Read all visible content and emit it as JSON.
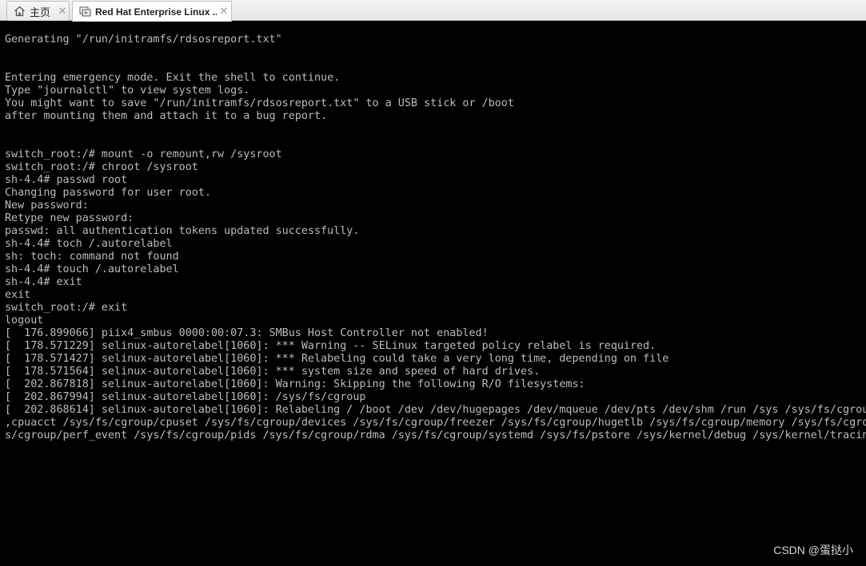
{
  "tabs": {
    "home": {
      "label": "主页",
      "icon": "home-icon"
    },
    "vm": {
      "label": "Red Hat Enterprise Linux ...",
      "icon": "vm-icon"
    }
  },
  "console": {
    "lines": [
      "Generating \"/run/initramfs/rdsosreport.txt\"",
      "",
      "",
      "Entering emergency mode. Exit the shell to continue.",
      "Type \"journalctl\" to view system logs.",
      "You might want to save \"/run/initramfs/rdsosreport.txt\" to a USB stick or /boot",
      "after mounting them and attach it to a bug report.",
      "",
      "",
      "switch_root:/# mount -o remount,rw /sysroot",
      "switch_root:/# chroot /sysroot",
      "sh-4.4# passwd root",
      "Changing password for user root.",
      "New password:",
      "Retype new password:",
      "passwd: all authentication tokens updated successfully.",
      "sh-4.4# toch /.autorelabel",
      "sh: toch: command not found",
      "sh-4.4# touch /.autorelabel",
      "sh-4.4# exit",
      "exit",
      "switch_root:/# exit",
      "logout",
      "[  176.899066] piix4_smbus 0000:00:07.3: SMBus Host Controller not enabled!",
      "[  178.571229] selinux-autorelabel[1060]: *** Warning -- SELinux targeted policy relabel is required.",
      "[  178.571427] selinux-autorelabel[1060]: *** Relabeling could take a very long time, depending on file",
      "[  178.571564] selinux-autorelabel[1060]: *** system size and speed of hard drives.",
      "[  202.867818] selinux-autorelabel[1060]: Warning: Skipping the following R/O filesystems:",
      "[  202.867994] selinux-autorelabel[1060]: /sys/fs/cgroup",
      "[  202.868614] selinux-autorelabel[1060]: Relabeling / /boot /dev /dev/hugepages /dev/mqueue /dev/pts /dev/shm /run /sys /sys/fs/cgroup",
      ",cpuacct /sys/fs/cgroup/cpuset /sys/fs/cgroup/devices /sys/fs/cgroup/freezer /sys/fs/cgroup/hugetlb /sys/fs/cgroup/memory /sys/fs/cgrou",
      "s/cgroup/perf_event /sys/fs/cgroup/pids /sys/fs/cgroup/rdma /sys/fs/cgroup/systemd /sys/fs/pstore /sys/kernel/debug /sys/kernel/tracing"
    ]
  },
  "watermark": "CSDN @蛋挞小"
}
